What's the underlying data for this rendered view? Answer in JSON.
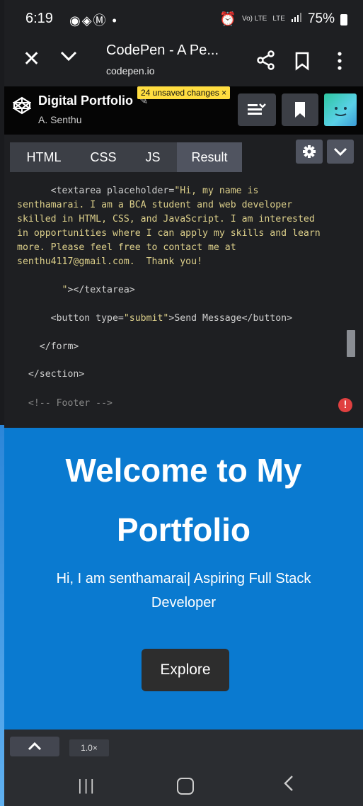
{
  "status": {
    "time": "6:19",
    "notif_icons": "◉◈Ⓜ •",
    "signal_small": "Vo) LTE",
    "lte": "LTE",
    "battery": "75%"
  },
  "browser": {
    "title": "CodePen - A Pe...",
    "url": "codepen.io",
    "close_icon": "close-icon",
    "chevron_icon": "chevron-down-icon"
  },
  "codepen": {
    "project_title": "Digital Portfolio",
    "edit_glyph": "✎",
    "author": "A. Senthu",
    "unsaved_badge": "24 unsaved changes",
    "badge_close": "×",
    "avatar_face": "◡"
  },
  "tabs": [
    {
      "label": "HTML"
    },
    {
      "label": "CSS"
    },
    {
      "label": "JS"
    },
    {
      "label": "Result"
    }
  ],
  "code": {
    "line1_pre": "      <textarea placeholder=",
    "line1_str": "\"Hi, my name is",
    "line2": "senthamarai. I am a BCA student and web developer",
    "line3": "skilled in HTML, CSS, and JavaScript. I am interested",
    "line4": "in opportunities where I can apply my skills and learn",
    "line5": "more. Please feel free to contact me at",
    "line6": "senthu4117@gmail.com.  Thank you!",
    "line7_str": "        \"",
    "line7_tag": "></textarea>",
    "line8_pre": "      <button type=",
    "line8_str": "\"submit\"",
    "line8_post": ">Send Message</button>",
    "line9": "    </form>",
    "line10": "  </section>",
    "line11": "  <!-- Footer -->",
    "error_glyph": "!"
  },
  "preview": {
    "heading_line1": "Welcome to My",
    "heading_line2": "Portfolio",
    "subtitle_line1": "Hi, I am senthamarai| Aspiring Full Stack",
    "subtitle_line2": "Developer",
    "button": "Explore"
  },
  "bottom_bar": {
    "zoom": "1.0×"
  },
  "colors": {
    "preview_bg": "#0a7ad0",
    "badge": "#ffdd40",
    "error": "#e04040"
  }
}
